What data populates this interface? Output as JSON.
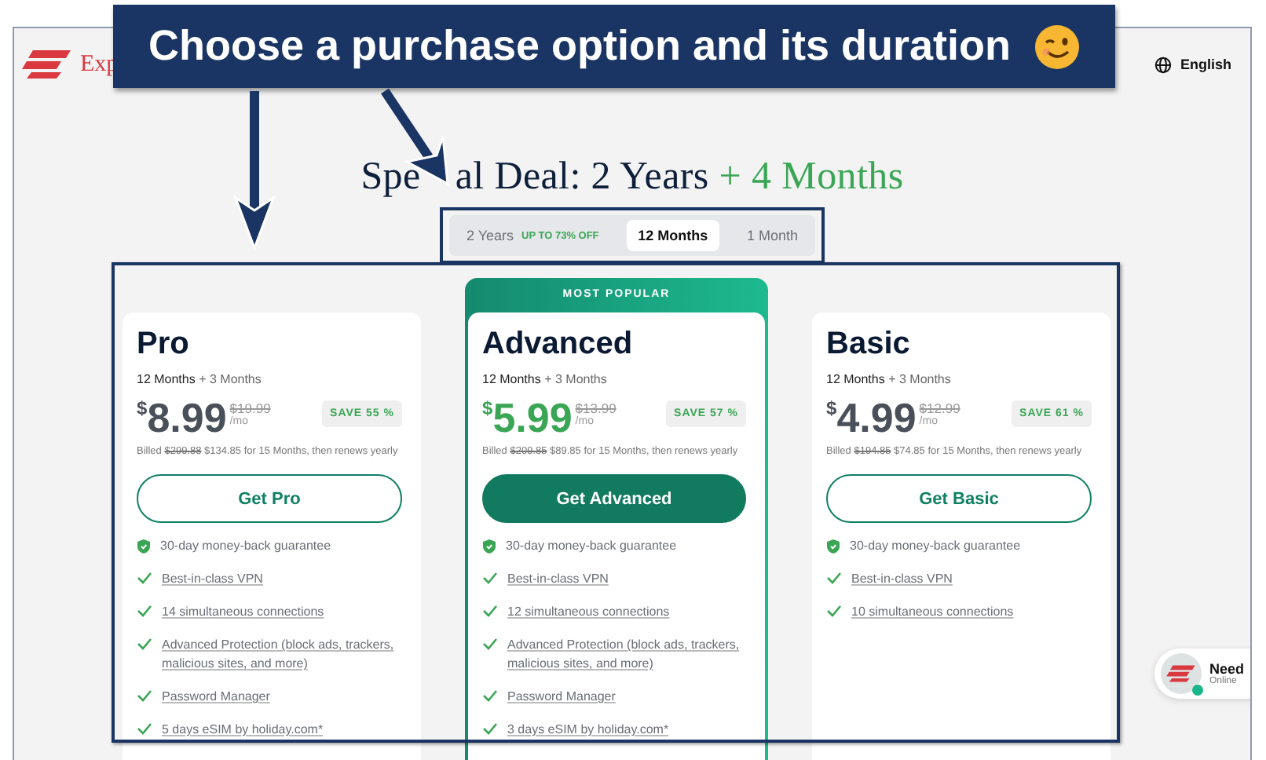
{
  "callout": {
    "text": "Choose a purchase option and its duration"
  },
  "header": {
    "logo_text": "Exp",
    "language": "English"
  },
  "heading": {
    "text_before": "Spe",
    "text_after": "al Deal: 2 Years",
    "bonus": "+ 4 Months"
  },
  "duration_tabs": [
    {
      "label": "2 Years",
      "badge": "UP TO 73% OFF",
      "selected": false
    },
    {
      "label": "12 Months",
      "selected": true
    },
    {
      "label": "1 Month",
      "selected": false
    }
  ],
  "plans": [
    {
      "name": "Pro",
      "popular": false,
      "term": "12 Months",
      "bonus": "+ 3 Months",
      "currency": "$",
      "price": "8.99",
      "old_price": "$19.99",
      "per": "/mo",
      "save": "SAVE 55 %",
      "billed_label": "Billed",
      "billed_old": "$299.88",
      "billed_text": "$134.85 for 15 Months, then renews yearly",
      "button": "Get Pro",
      "features": [
        {
          "kind": "shield",
          "text": "30-day money-back guarantee"
        },
        {
          "kind": "check",
          "text": "Best-in-class VPN"
        },
        {
          "kind": "check",
          "text": "14 simultaneous connections"
        },
        {
          "kind": "check",
          "text": "Advanced Protection (block ads, trackers, malicious sites, and more)"
        },
        {
          "kind": "check",
          "text": "Password Manager"
        },
        {
          "kind": "check",
          "text": "5 days eSIM by holiday.com*"
        }
      ]
    },
    {
      "name": "Advanced",
      "popular": true,
      "ribbon": "MOST POPULAR",
      "term": "12 Months",
      "bonus": "+ 3 Months",
      "currency": "$",
      "price": "5.99",
      "old_price": "$13.99",
      "per": "/mo",
      "save": "SAVE 57 %",
      "billed_label": "Billed",
      "billed_old": "$209.85",
      "billed_text": "$89.85 for 15 Months, then renews yearly",
      "button": "Get Advanced",
      "features": [
        {
          "kind": "shield",
          "text": "30-day money-back guarantee"
        },
        {
          "kind": "check",
          "text": "Best-in-class VPN"
        },
        {
          "kind": "check",
          "text": "12 simultaneous connections"
        },
        {
          "kind": "check",
          "text": "Advanced Protection (block ads, trackers, malicious sites, and more)"
        },
        {
          "kind": "check",
          "text": "Password Manager"
        },
        {
          "kind": "check",
          "text": "3 days eSIM by holiday.com*"
        }
      ]
    },
    {
      "name": "Basic",
      "popular": false,
      "term": "12 Months",
      "bonus": "+ 3 Months",
      "currency": "$",
      "price": "4.99",
      "old_price": "$12.99",
      "per": "/mo",
      "save": "SAVE 61 %",
      "billed_label": "Billed",
      "billed_old": "$194.85",
      "billed_text": "$74.85 for 15 Months, then renews yearly",
      "button": "Get Basic",
      "features": [
        {
          "kind": "shield",
          "text": "30-day money-back guarantee"
        },
        {
          "kind": "check",
          "text": "Best-in-class VPN"
        },
        {
          "kind": "check",
          "text": "10 simultaneous connections"
        }
      ]
    }
  ],
  "chat": {
    "title": "Need",
    "status": "Online"
  }
}
